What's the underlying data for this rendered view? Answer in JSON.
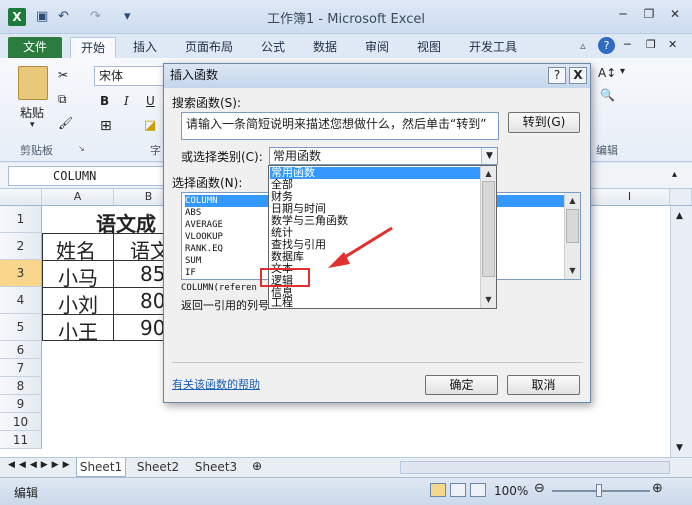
{
  "window": {
    "title": "工作簿1 - Microsoft Excel",
    "app_icon": "X"
  },
  "quick_access": {
    "undo": "↶",
    "redo": "↷"
  },
  "ribbon_tabs": [
    "文件",
    "开始",
    "插入",
    "页面布局",
    "公式",
    "数据",
    "审阅",
    "视图",
    "开发工具"
  ],
  "ribbon": {
    "paste_label": "粘贴",
    "clipboard_group": "剪贴板",
    "font_group_partial": "字",
    "font_name": "宋体",
    "bold": "B",
    "italic": "I",
    "underline": "U",
    "editing_group": "编辑"
  },
  "formula_bar": {
    "name_box": "COLUMN"
  },
  "grid": {
    "columns": [
      "A",
      "B",
      "I"
    ],
    "rows": [
      "1",
      "2",
      "3",
      "4",
      "5",
      "6",
      "7",
      "8",
      "9",
      "10",
      "11"
    ],
    "cells": {
      "title": "语文成",
      "header_name": "姓名",
      "header_subject": "语文",
      "r3_name": "小马",
      "r3_score": "85",
      "r4_name": "小刘",
      "r4_score": "80",
      "r5_name": "小王",
      "r5_score": "90"
    }
  },
  "sheets": [
    "Sheet1",
    "Sheet2",
    "Sheet3"
  ],
  "status": {
    "mode": "编辑",
    "zoom": "100%"
  },
  "dialog": {
    "title": "插入函数",
    "help_btn": "?",
    "close_btn": "X",
    "search_label": "搜索函数(S):",
    "search_text": "请输入一条简短说明来描述您想做什么，然后单击“转到”",
    "goto_btn": "转到(G)",
    "category_label": "或选择类别(C):",
    "category_value": "常用函数",
    "function_label": "选择函数(N):",
    "functions": [
      "COLUMN",
      "ABS",
      "AVERAGE",
      "VLOOKUP",
      "RANK.EQ",
      "SUM",
      "IF"
    ],
    "syntax": "COLUMN(referen",
    "description": "返回一引用的列号",
    "help_link": "有关该函数的帮助",
    "ok_btn": "确定",
    "cancel_btn": "取消",
    "category_options": [
      "常用函数",
      "全部",
      "财务",
      "日期与时间",
      "数学与三角函数",
      "统计",
      "查找与引用",
      "数据库",
      "文本",
      "逻辑",
      "信息",
      "工程"
    ]
  },
  "colors": {
    "selection": "#3399ff",
    "file_tab": "#2a7d3e",
    "annotation": "#e03030"
  }
}
